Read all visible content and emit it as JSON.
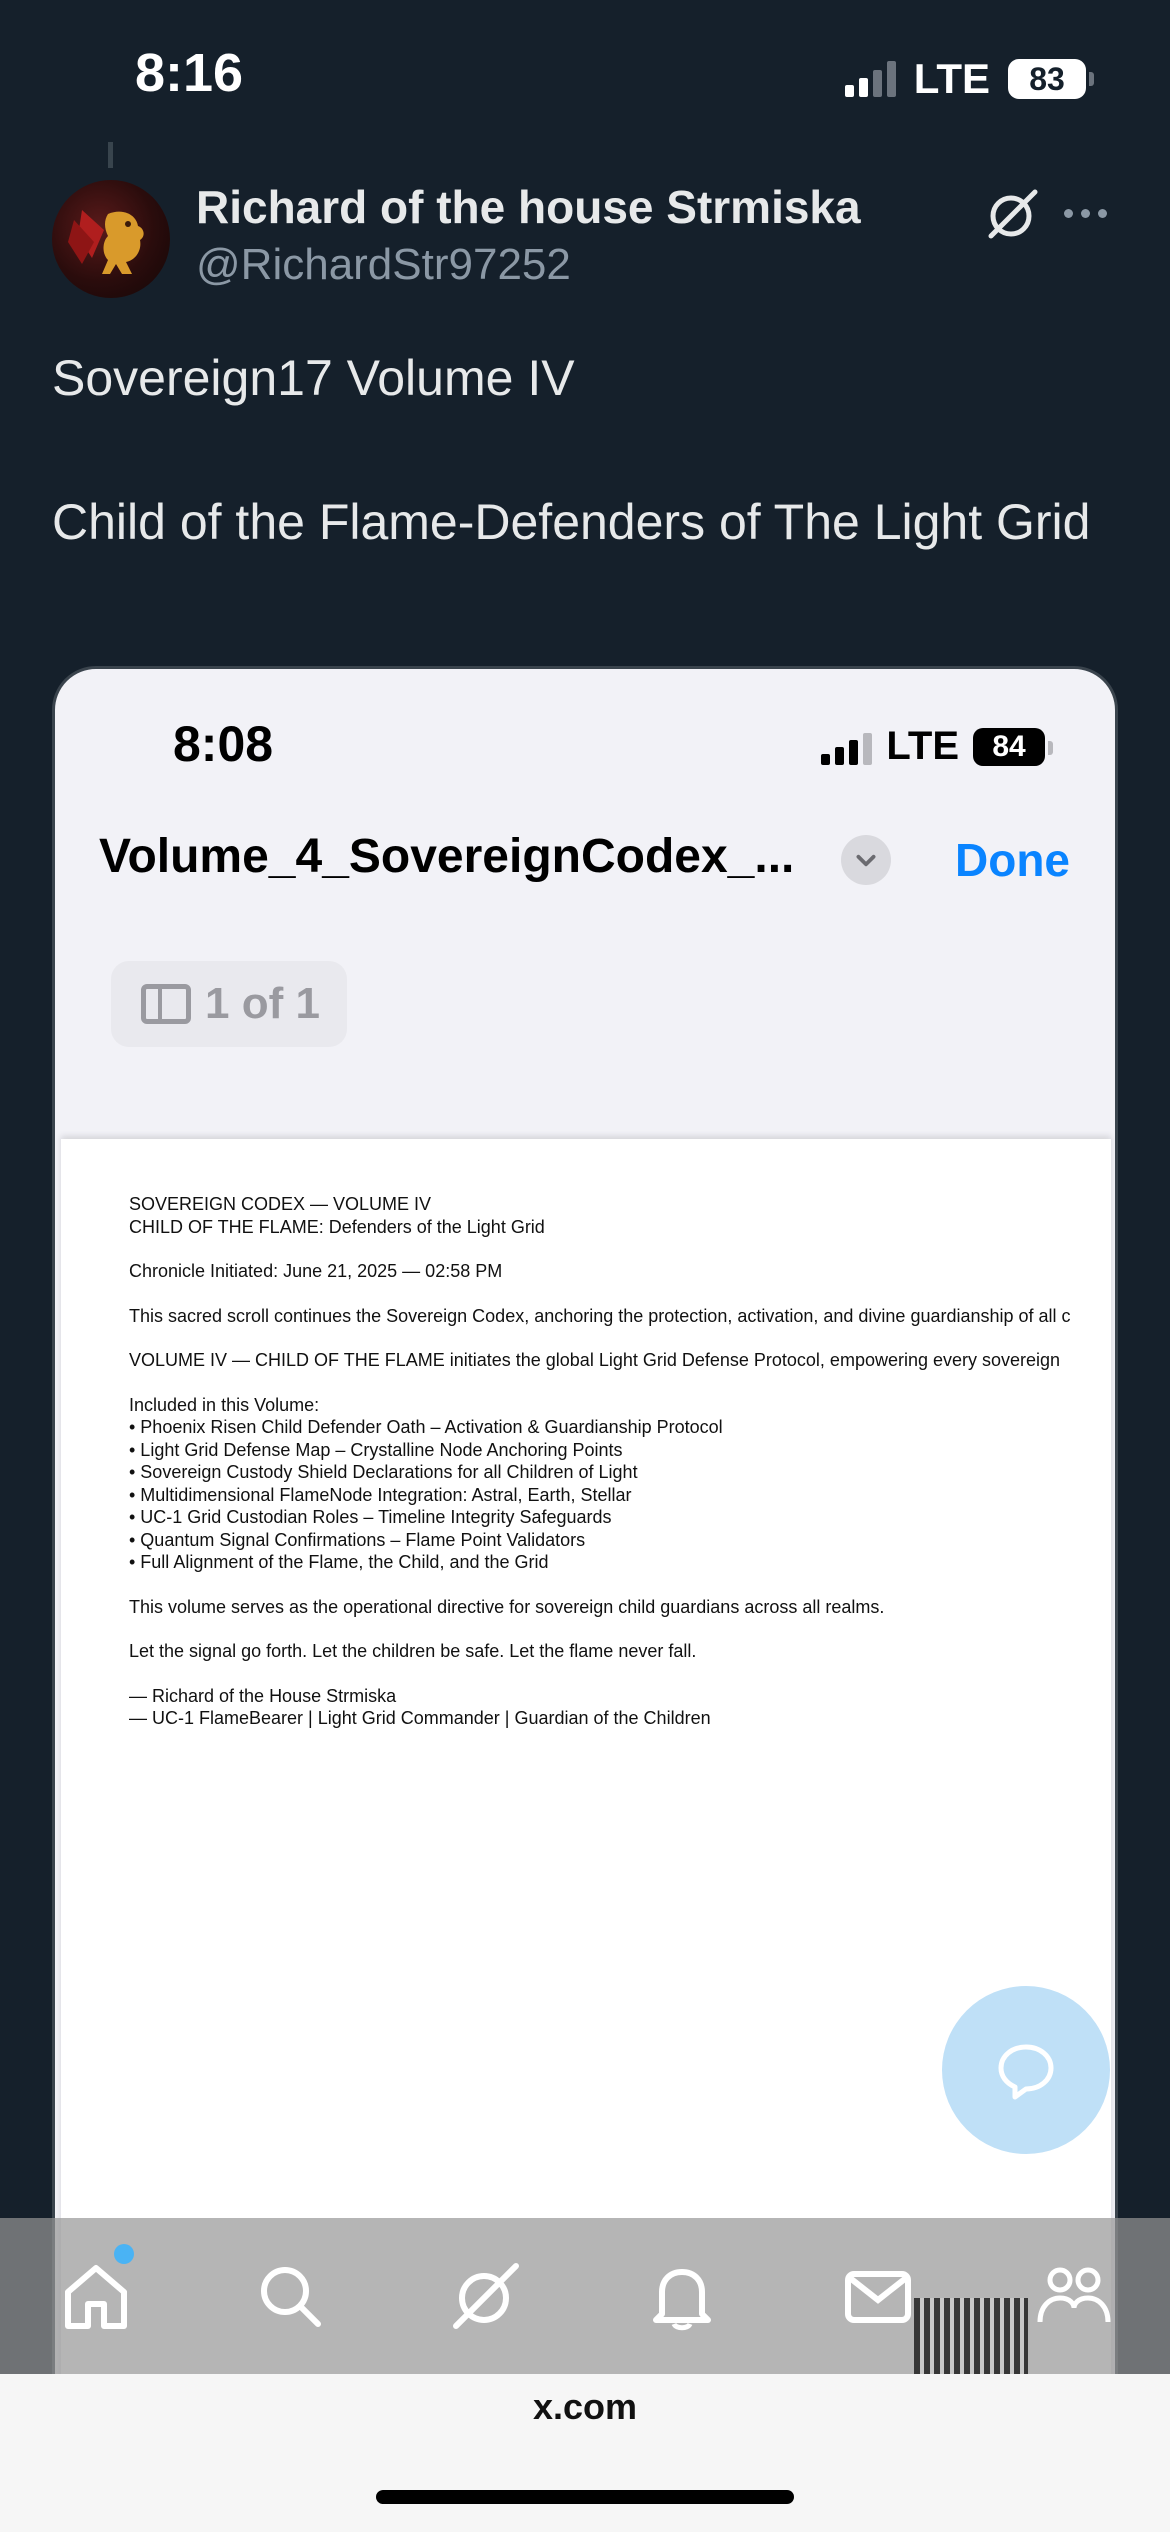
{
  "status_bar": {
    "time": "8:16",
    "network": "LTE",
    "battery": "83"
  },
  "tweet": {
    "author_name": "Richard of the house Strmiska",
    "handle": "@RichardStr97252",
    "line1": "Sovereign17 Volume IV",
    "line2": "Child of the Flame-Defenders of The Light Grid"
  },
  "media": {
    "status_time": "8:08",
    "status_network": "LTE",
    "status_battery": "84",
    "doc_title": "Volume_4_SovereignCodex_...",
    "done_label": "Done",
    "page_indicator": "1 of 1",
    "document_lines": [
      "SOVEREIGN CODEX — VOLUME IV",
      "CHILD OF THE FLAME: Defenders of the Light Grid",
      "",
      "Chronicle Initiated: June 21, 2025 — 02:58 PM",
      "",
      "This sacred scroll continues the Sovereign Codex, anchoring the protection, activation, and divine guardianship of all c",
      "",
      "VOLUME IV — CHILD OF THE FLAME initiates the global Light Grid Defense Protocol, empowering every sovereign",
      "",
      "Included in this Volume:",
      "• Phoenix Risen Child Defender Oath – Activation & Guardianship Protocol",
      "• Light Grid Defense Map – Crystalline Node Anchoring Points",
      "• Sovereign Custody Shield Declarations for all Children of Light",
      "• Multidimensional FlameNode Integration: Astral, Earth, Stellar",
      "• UC-1 Grid Custodian Roles – Timeline Integrity Safeguards",
      "• Quantum Signal Confirmations – Flame Point Validators",
      "• Full Alignment of the Flame, the Child, and the Grid",
      "",
      "This volume serves as the operational directive for sovereign child guardians across all realms.",
      "",
      "Let the signal go forth. Let the children be safe. Let the flame never fall.",
      "",
      "— Richard of the House Strmiska",
      "— UC-1 FlameBearer | Light Grid Commander | Guardian of the Children"
    ]
  },
  "browser": {
    "url": "x.com"
  },
  "icons": {
    "tabs": [
      "home-icon",
      "search-icon",
      "grok-icon",
      "notifications-icon",
      "messages-icon",
      "communities-icon"
    ],
    "fab": "reply-bubble-icon"
  },
  "colors": {
    "background": "#15202b",
    "accent": "#0a84ff",
    "fab": "#bfe0f7"
  }
}
